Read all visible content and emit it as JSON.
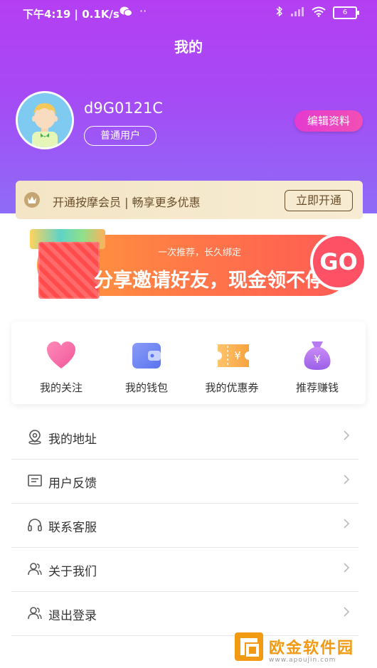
{
  "status_bar": {
    "time_speed": "下午4:19 | 0.1K/s",
    "battery": "6"
  },
  "header": {
    "title": "我的"
  },
  "user": {
    "name": "d9G0121C",
    "tag": "普通用户",
    "edit_label": "编辑资料"
  },
  "vip": {
    "text": "开通按摩会员 | 畅享更多优惠",
    "button": "立即开通"
  },
  "banner": {
    "subtitle": "一次推荐，长久绑定",
    "title": "分享邀请好友，现金领不停",
    "go": "GO"
  },
  "quick_actions": [
    {
      "label": "我的关注",
      "icon": "heart-icon"
    },
    {
      "label": "我的钱包",
      "icon": "wallet-icon"
    },
    {
      "label": "我的优惠券",
      "icon": "coupon-icon"
    },
    {
      "label": "推荐赚钱",
      "icon": "money-bag-icon"
    }
  ],
  "menu": [
    {
      "label": "我的地址",
      "icon": "location-icon"
    },
    {
      "label": "用户反馈",
      "icon": "feedback-icon"
    },
    {
      "label": "联系客服",
      "icon": "headset-icon"
    },
    {
      "label": "关于我们",
      "icon": "users-icon"
    },
    {
      "label": "退出登录",
      "icon": "logout-user-icon"
    }
  ],
  "watermark": {
    "text": "欧金软件园",
    "url": "www.apoujin.com"
  },
  "colors": {
    "header_gradient_top": "#b43ff2",
    "header_gradient_bottom": "#8e6cf7",
    "edit_button": "#e43ad0",
    "vip_bg": "#f3e5c5",
    "vip_text": "#6a4e2b",
    "banner_orange": "#ff7a47",
    "watermark": "#f29a13"
  }
}
